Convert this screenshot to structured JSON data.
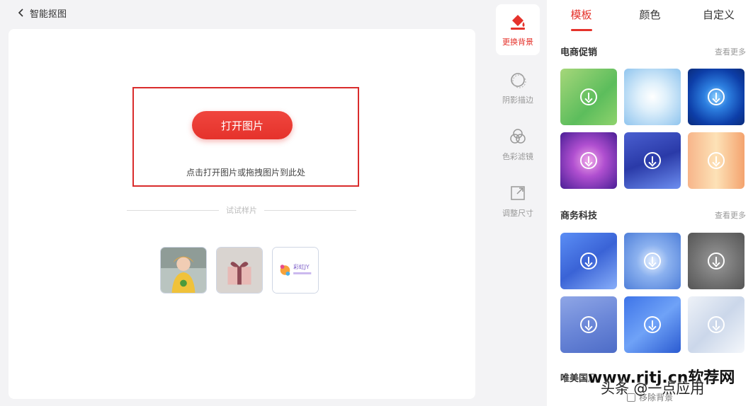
{
  "header": {
    "back_label": "智能抠图"
  },
  "upload": {
    "open_button": "打开图片",
    "hint": "点击打开图片或拖拽图片到此处",
    "samples_label": "试试样片",
    "samples": [
      {
        "name": "sample-portrait"
      },
      {
        "name": "sample-gift-box"
      },
      {
        "name": "sample-logo",
        "text": "彩虹JY"
      }
    ]
  },
  "toolbar": {
    "items": [
      {
        "label": "更换背景",
        "icon": "paint-bucket-icon",
        "active": true
      },
      {
        "label": "阴影描边",
        "icon": "shadow-circle-icon",
        "active": false
      },
      {
        "label": "色彩滤镜",
        "icon": "color-circles-icon",
        "active": false
      },
      {
        "label": "调整尺寸",
        "icon": "resize-icon",
        "active": false
      }
    ]
  },
  "panel": {
    "tabs": [
      {
        "label": "模板",
        "active": true
      },
      {
        "label": "颜色",
        "active": false
      },
      {
        "label": "自定义",
        "active": false
      }
    ],
    "sections": [
      {
        "title": "电商促销",
        "more": "查看更多"
      },
      {
        "title": "商务科技",
        "more": "查看更多"
      },
      {
        "title": "唯美国风"
      }
    ],
    "remove_bg": "移除背景"
  },
  "watermark": {
    "line1": "www.rjtj.cn软荐网",
    "line2": "头条 @一点应用"
  },
  "colors": {
    "accent": "#e5322b",
    "highlight_box": "#d92c2c"
  }
}
